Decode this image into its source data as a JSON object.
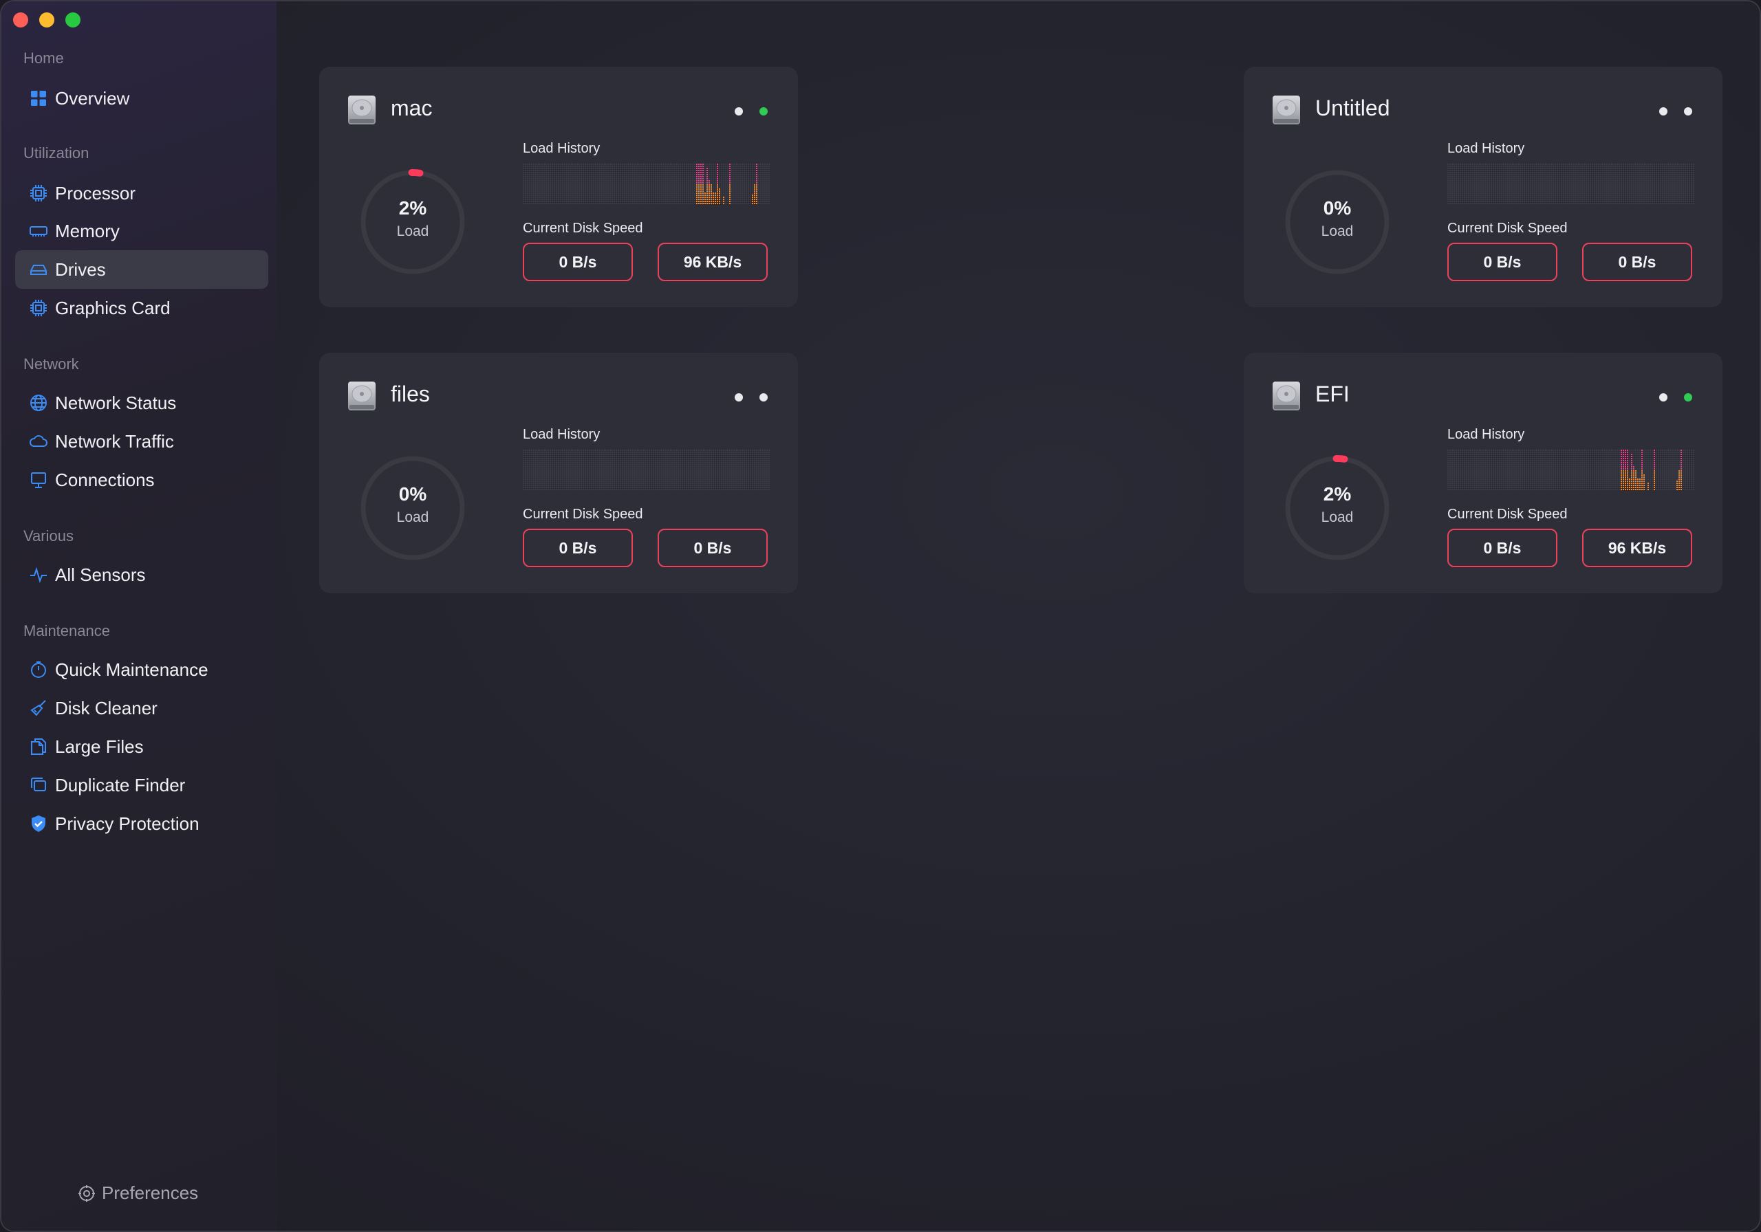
{
  "window": {
    "controls": [
      "close",
      "minimize",
      "zoom"
    ]
  },
  "sidebar": {
    "sections": [
      {
        "title": "Home",
        "items": [
          {
            "label": "Overview",
            "icon": "overview-grid-icon"
          }
        ]
      },
      {
        "title": "Utilization",
        "items": [
          {
            "label": "Processor",
            "icon": "processor-icon"
          },
          {
            "label": "Memory",
            "icon": "memory-icon"
          },
          {
            "label": "Drives",
            "icon": "drive-icon",
            "active": true
          },
          {
            "label": "Graphics Card",
            "icon": "graphics-card-icon"
          }
        ]
      },
      {
        "title": "Network",
        "items": [
          {
            "label": "Network Status",
            "icon": "globe-icon"
          },
          {
            "label": "Network Traffic",
            "icon": "cloud-icon"
          },
          {
            "label": "Connections",
            "icon": "monitor-icon"
          }
        ]
      },
      {
        "title": "Various",
        "items": [
          {
            "label": "All Sensors",
            "icon": "pulse-icon"
          }
        ]
      },
      {
        "title": "Maintenance",
        "items": [
          {
            "label": "Quick Maintenance",
            "icon": "stopwatch-icon"
          },
          {
            "label": "Disk Cleaner",
            "icon": "broom-icon"
          },
          {
            "label": "Large Files",
            "icon": "documents-icon"
          },
          {
            "label": "Duplicate Finder",
            "icon": "duplicate-icon"
          },
          {
            "label": "Privacy Protection",
            "icon": "shield-check-icon"
          }
        ]
      }
    ],
    "preferences_label": "Preferences"
  },
  "labels": {
    "load": "Load",
    "load_history": "Load History",
    "current_disk_speed": "Current Disk Speed"
  },
  "drives": [
    {
      "name": "mac",
      "load_pct": 2,
      "load_text": "2%",
      "read_speed": "0 B/s",
      "write_speed": "96 KB/s",
      "active_indicator": true,
      "history": [
        0,
        0,
        0,
        0,
        0,
        0,
        0,
        0,
        0,
        0,
        0,
        0,
        0,
        0,
        0,
        0,
        0,
        0,
        0,
        0,
        0,
        0,
        0,
        0,
        0,
        0,
        0,
        0,
        0,
        0,
        0,
        0,
        0,
        0,
        0,
        0,
        0,
        0,
        0,
        0,
        0,
        0,
        0,
        0,
        0,
        0,
        0,
        0,
        0,
        0,
        0,
        0,
        0,
        0,
        0,
        0,
        0,
        0,
        0,
        0,
        0,
        0,
        0,
        0,
        0,
        0,
        0,
        0,
        0,
        0,
        0,
        0,
        0,
        0,
        0,
        0,
        0,
        0,
        0,
        0,
        0,
        0,
        0,
        0,
        1.0,
        1.0,
        1.0,
        1.0,
        0.3,
        0.9,
        0.6,
        0.5,
        0.3,
        0.3,
        1.0,
        0.4,
        0,
        0.2,
        0,
        0,
        1.0,
        0,
        0,
        0,
        0,
        0,
        0,
        0,
        0,
        0,
        0,
        0.25,
        0.5,
        1.0,
        0,
        0
      ]
    },
    {
      "name": "Untitled",
      "load_pct": 0,
      "load_text": "0%",
      "read_speed": "0 B/s",
      "write_speed": "0 B/s",
      "active_indicator": false,
      "history": []
    },
    {
      "name": "files",
      "load_pct": 0,
      "load_text": "0%",
      "read_speed": "0 B/s",
      "write_speed": "0 B/s",
      "active_indicator": false,
      "history": []
    },
    {
      "name": "EFI",
      "load_pct": 2,
      "load_text": "2%",
      "read_speed": "0 B/s",
      "write_speed": "96 KB/s",
      "active_indicator": true,
      "history": [
        0,
        0,
        0,
        0,
        0,
        0,
        0,
        0,
        0,
        0,
        0,
        0,
        0,
        0,
        0,
        0,
        0,
        0,
        0,
        0,
        0,
        0,
        0,
        0,
        0,
        0,
        0,
        0,
        0,
        0,
        0,
        0,
        0,
        0,
        0,
        0,
        0,
        0,
        0,
        0,
        0,
        0,
        0,
        0,
        0,
        0,
        0,
        0,
        0,
        0,
        0,
        0,
        0,
        0,
        0,
        0,
        0,
        0,
        0,
        0,
        0,
        0,
        0,
        0,
        0,
        0,
        0,
        0,
        0,
        0,
        0,
        0,
        0,
        0,
        0,
        0,
        0,
        0,
        0,
        0,
        0,
        0,
        0,
        0,
        1.0,
        1.0,
        1.0,
        1.0,
        0.3,
        0.9,
        0.6,
        0.5,
        0.3,
        0.3,
        1.0,
        0.4,
        0,
        0.2,
        0,
        0,
        1.0,
        0,
        0,
        0,
        0,
        0,
        0,
        0,
        0,
        0,
        0,
        0.25,
        0.5,
        1.0,
        0,
        0
      ]
    }
  ],
  "colors": {
    "accent_blue": "#3b8cf5",
    "speed_border": "#e8435a",
    "gauge_indicator": "#ff3b5c",
    "indicator_green": "#2ecc52",
    "history_top": "#e0448a",
    "history_bottom": "#f08a2c"
  }
}
